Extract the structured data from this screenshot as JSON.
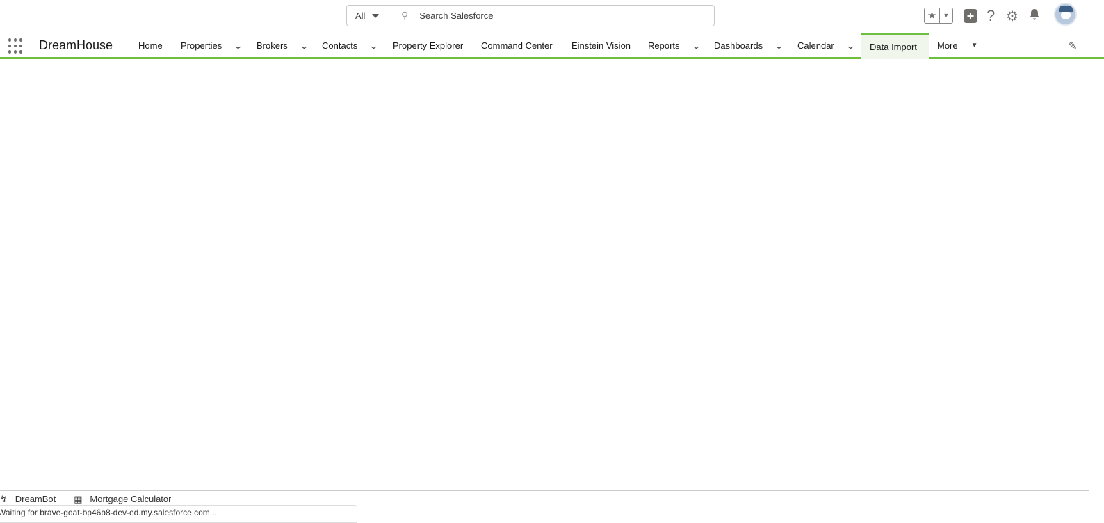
{
  "search": {
    "scope": "All",
    "placeholder": "Search Salesforce"
  },
  "app": {
    "name": "DreamHouse"
  },
  "nav": {
    "items": [
      {
        "label": "Home"
      },
      {
        "label": "Properties"
      },
      {
        "label": "Brokers"
      },
      {
        "label": "Contacts"
      },
      {
        "label": "Property Explorer"
      },
      {
        "label": "Command Center"
      },
      {
        "label": "Einstein Vision"
      },
      {
        "label": "Reports"
      },
      {
        "label": "Dashboards"
      },
      {
        "label": "Calendar"
      },
      {
        "label": "Data Import"
      },
      {
        "label": "More"
      }
    ],
    "active": "Data Import"
  },
  "utility": {
    "items": [
      {
        "label": "DreamBot"
      },
      {
        "label": "Mortgage Calculator"
      }
    ]
  },
  "status": {
    "text": "Waiting for brave-goat-bp46b8-dev-ed.my.salesforce.com..."
  },
  "colors": {
    "accent": "#6cbf3f"
  }
}
